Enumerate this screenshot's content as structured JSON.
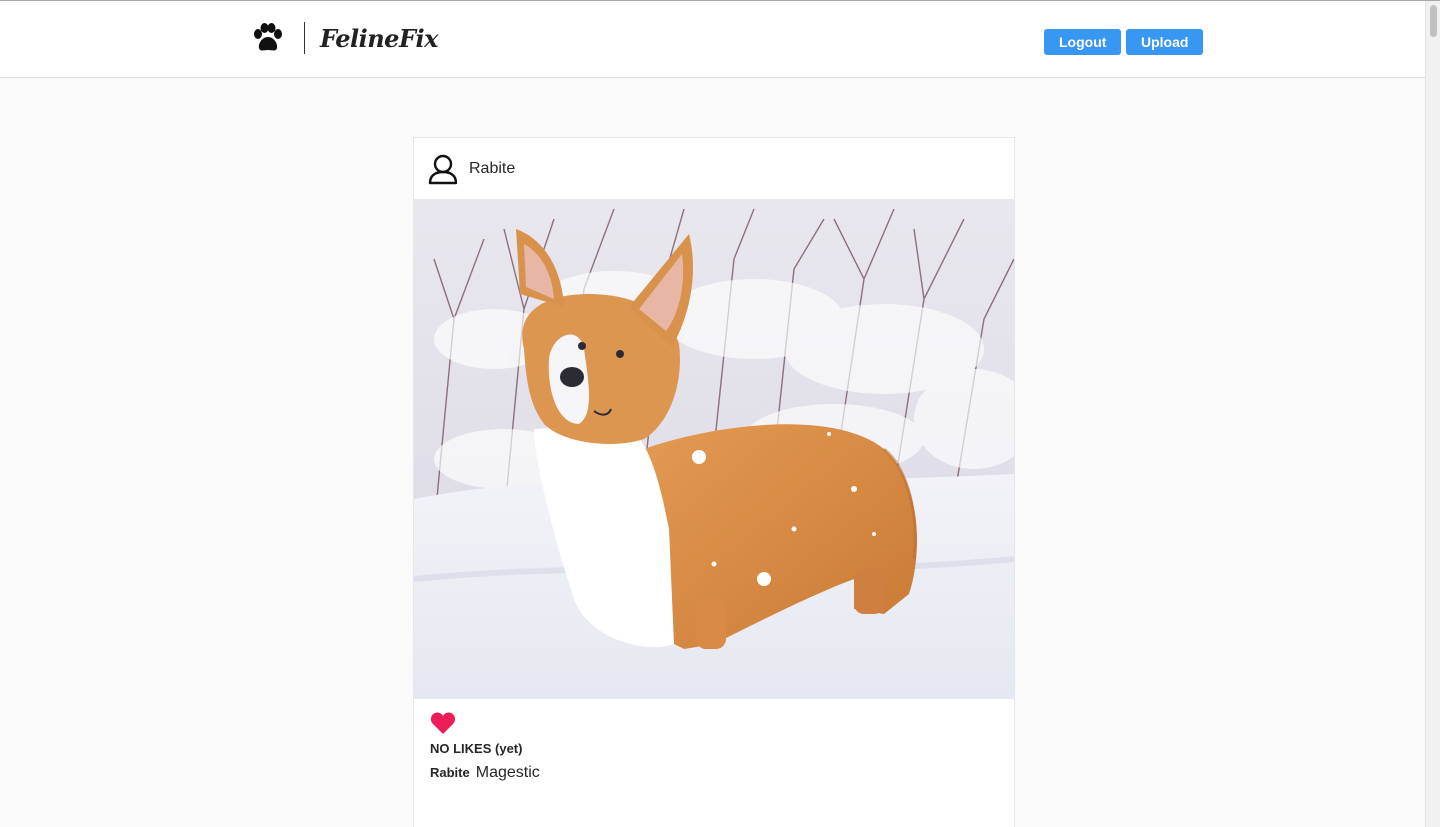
{
  "navbar": {
    "logo_icon": "paw-icon",
    "brand": "FelineFix",
    "logout_label": "Logout",
    "upload_label": "Upload",
    "accent_color": "#3897f0"
  },
  "post": {
    "avatar_icon": "user-outline-icon",
    "username": "Rabite",
    "image_alt": "Corgi standing in snow",
    "like_icon": "heart-icon",
    "like_color": "#ed1e57",
    "likes_text": "NO LIKES (yet)",
    "caption_user": "Rabite",
    "caption_text": "Magestic"
  }
}
